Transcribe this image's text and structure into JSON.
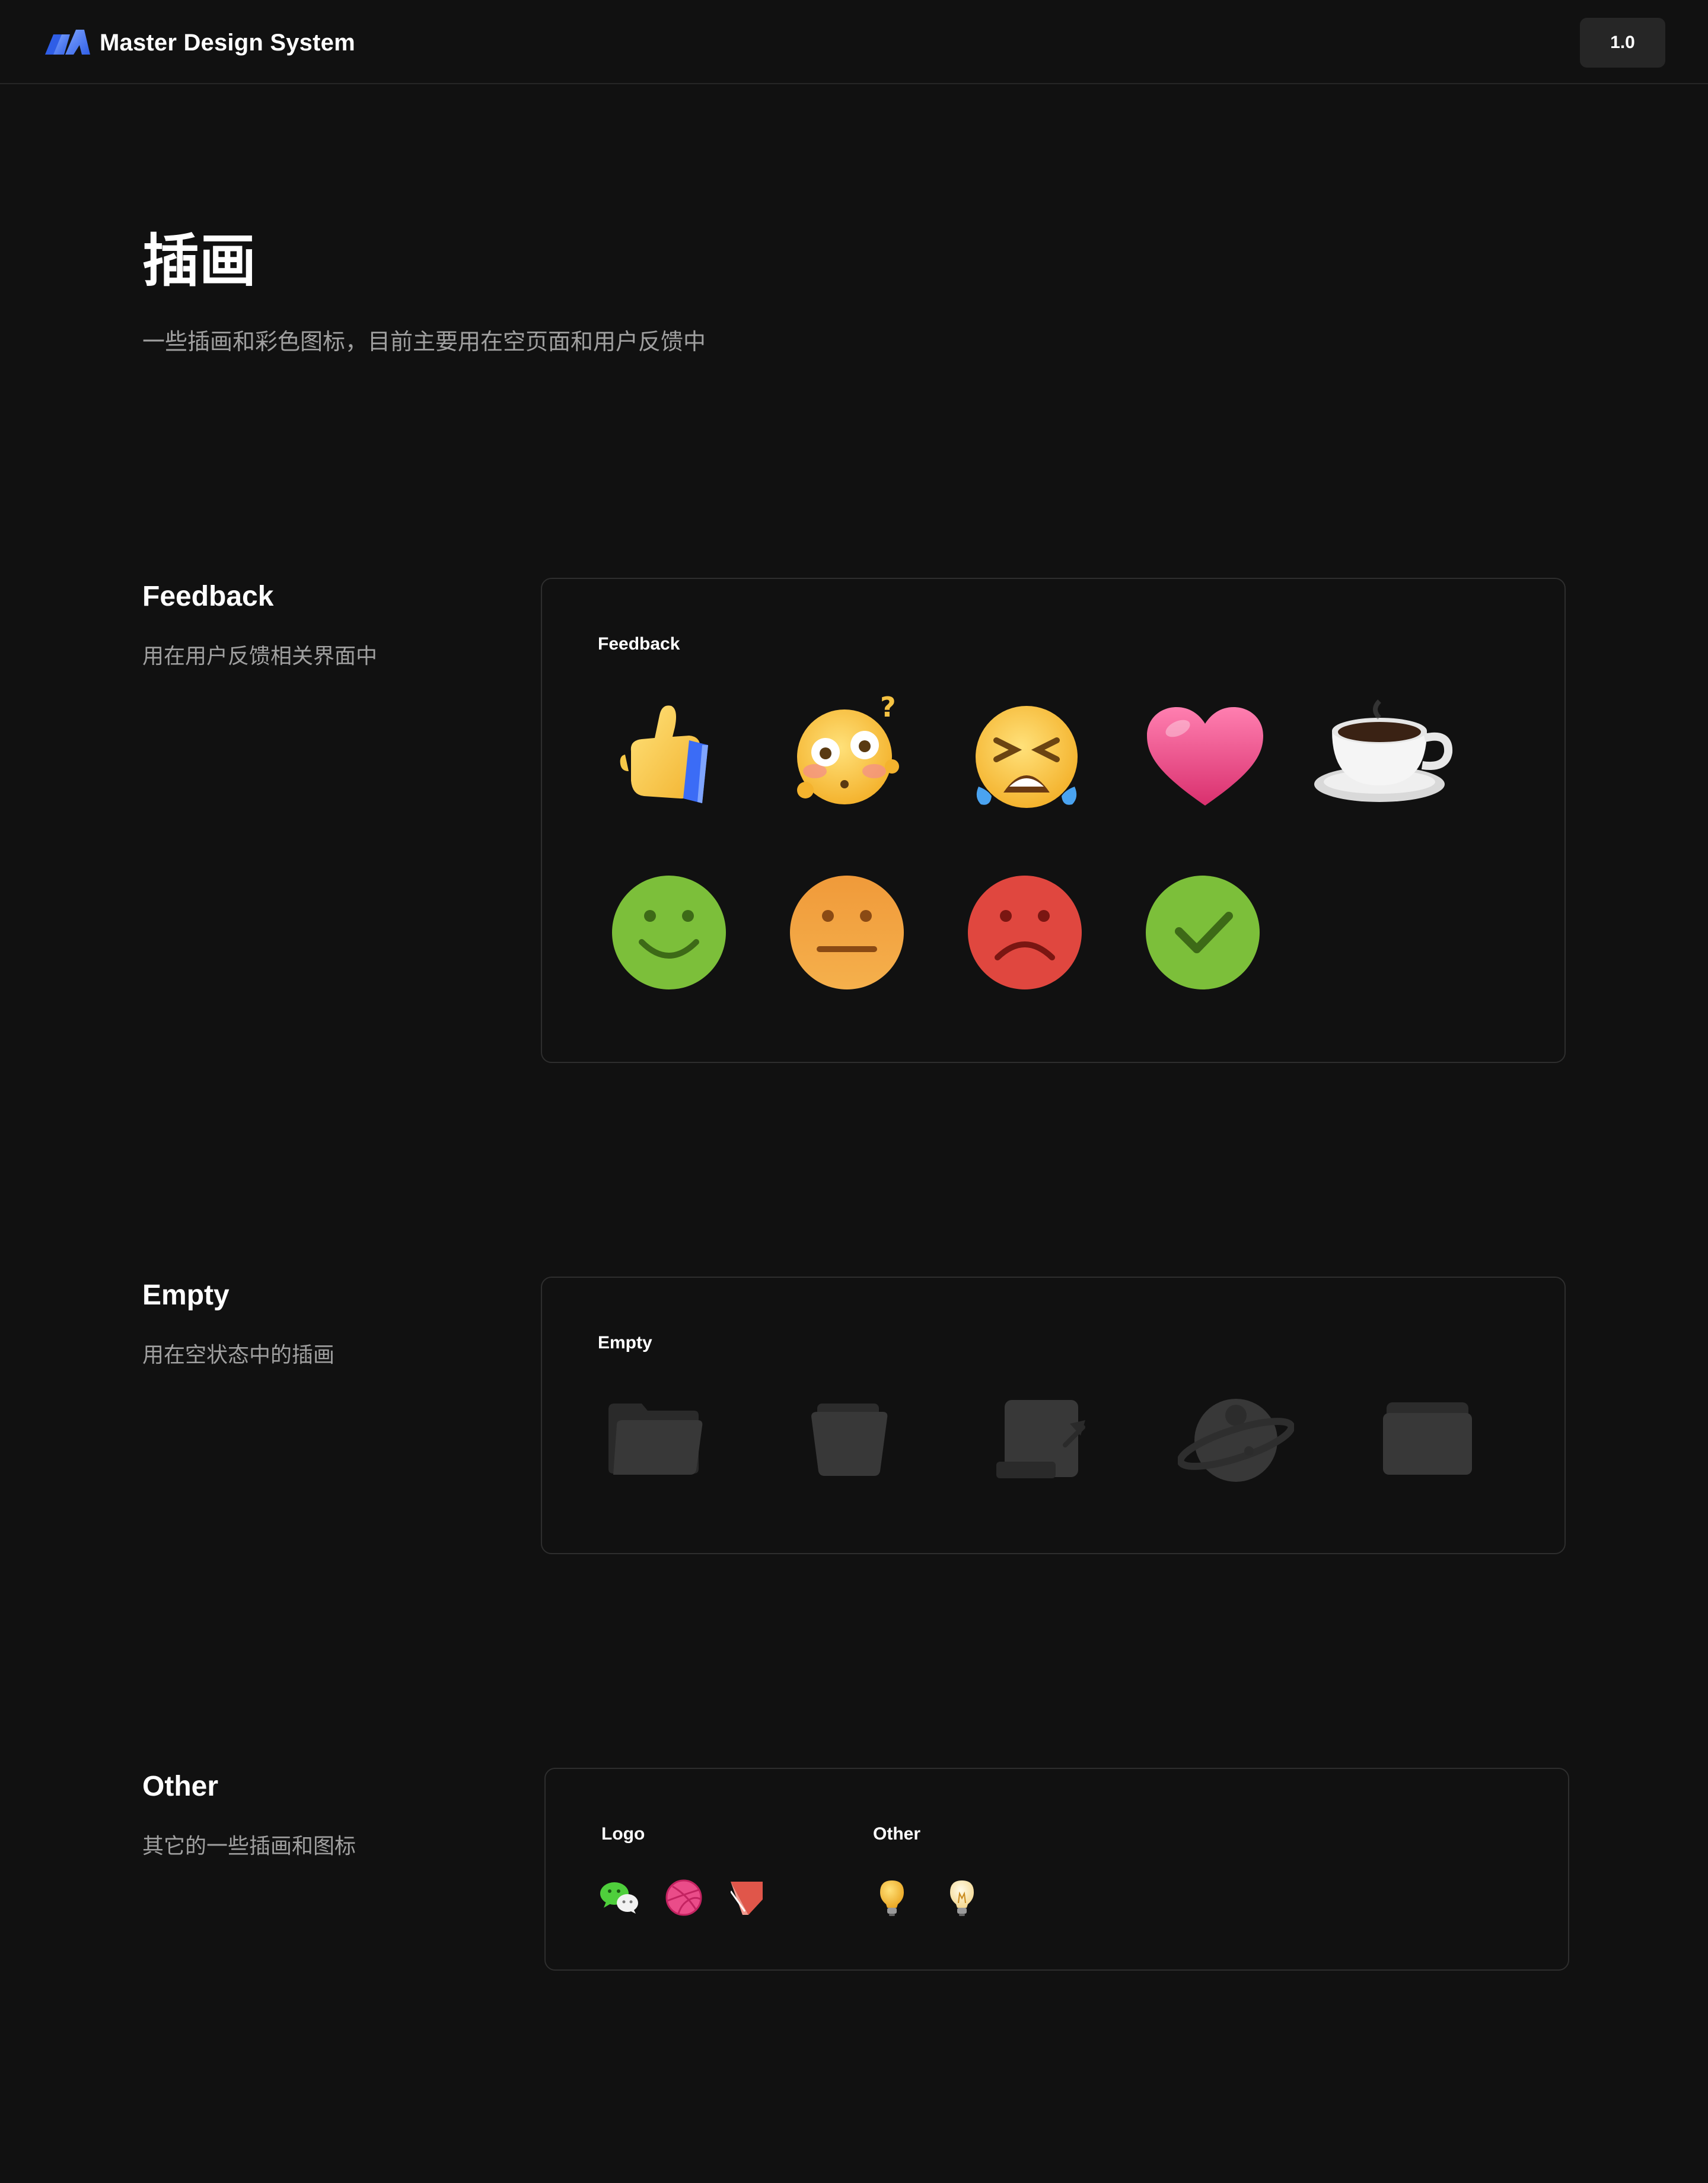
{
  "header": {
    "brand": "Master Design System",
    "version": "1.0"
  },
  "page": {
    "title": "插画",
    "description": "一些插画和彩色图标，目前主要用在空页面和用户反馈中"
  },
  "sections": {
    "feedback": {
      "title": "Feedback",
      "description": "用在用户反馈相关界面中",
      "card_label": "Feedback",
      "items": [
        "thumbs-up",
        "flushed-face",
        "crying-face",
        "heart",
        "coffee-cup",
        "happy-face",
        "neutral-face",
        "sad-face",
        "check-circle"
      ]
    },
    "empty": {
      "title": "Empty",
      "description": "用在空状态中的插画",
      "card_label": "Empty",
      "items": [
        "open-folder",
        "empty-box",
        "scroll",
        "planet",
        "closed-folder"
      ]
    },
    "other": {
      "title": "Other",
      "description": "其它的一些插画和图标",
      "logo_label": "Logo",
      "other_label": "Other",
      "logos": [
        "wechat-logo",
        "dribbble-logo",
        "bookmark-logo"
      ],
      "others": [
        "lightbulb-off",
        "lightbulb-on"
      ]
    }
  },
  "colors": {
    "background": "#111111",
    "card_border": "#2e2e2e",
    "muted_text": "#a0a0a0",
    "accent_blue": "#3b6cf6",
    "happy_green": "#7cbf3a",
    "neutral_orange": "#f0a03c",
    "sad_red": "#e0473f",
    "heart_pink": "#f0508e"
  }
}
